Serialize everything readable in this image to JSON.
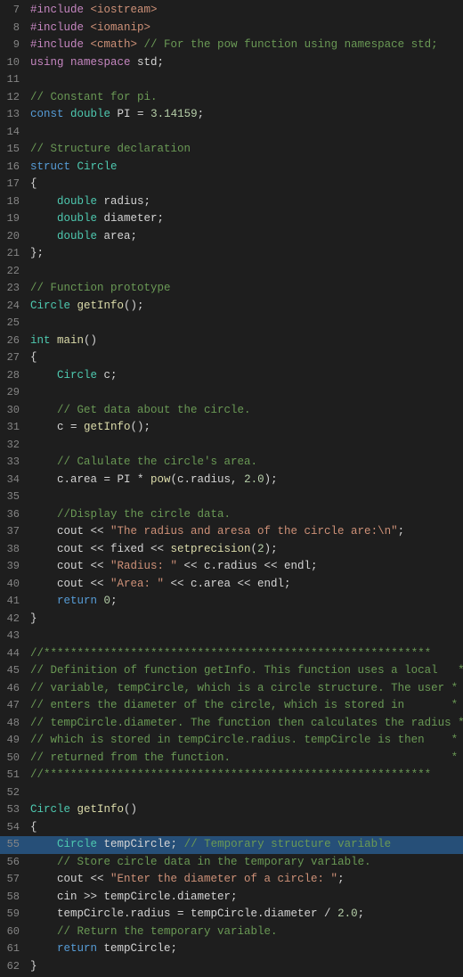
{
  "lines": [
    {
      "num": 7,
      "tokens": [
        {
          "t": "pp",
          "v": "#include"
        },
        {
          "t": "plain",
          "v": " "
        },
        {
          "t": "inc",
          "v": "<iostream>"
        }
      ]
    },
    {
      "num": 8,
      "tokens": [
        {
          "t": "pp",
          "v": "#include"
        },
        {
          "t": "plain",
          "v": " "
        },
        {
          "t": "inc",
          "v": "<iomanip>"
        }
      ]
    },
    {
      "num": 9,
      "tokens": [
        {
          "t": "pp",
          "v": "#include"
        },
        {
          "t": "plain",
          "v": " "
        },
        {
          "t": "inc",
          "v": "<cmath>"
        },
        {
          "t": "cmt",
          "v": " // For the pow function using namespace std;"
        }
      ]
    },
    {
      "num": 10,
      "tokens": [
        {
          "t": "kw2",
          "v": "using"
        },
        {
          "t": "plain",
          "v": " "
        },
        {
          "t": "kw2",
          "v": "namespace"
        },
        {
          "t": "plain",
          "v": " std;"
        }
      ]
    },
    {
      "num": 11,
      "tokens": []
    },
    {
      "num": 12,
      "tokens": [
        {
          "t": "cmt",
          "v": "// Constant for pi."
        }
      ]
    },
    {
      "num": 13,
      "tokens": [
        {
          "t": "kw",
          "v": "const"
        },
        {
          "t": "plain",
          "v": " "
        },
        {
          "t": "type",
          "v": "double"
        },
        {
          "t": "plain",
          "v": " PI = "
        },
        {
          "t": "num",
          "v": "3.14159"
        },
        {
          "t": "plain",
          "v": ";"
        }
      ]
    },
    {
      "num": 14,
      "tokens": []
    },
    {
      "num": 15,
      "tokens": [
        {
          "t": "cmt",
          "v": "// Structure declaration"
        }
      ]
    },
    {
      "num": 16,
      "tokens": [
        {
          "t": "kw",
          "v": "struct"
        },
        {
          "t": "plain",
          "v": " "
        },
        {
          "t": "type",
          "v": "Circle"
        }
      ]
    },
    {
      "num": 17,
      "tokens": [
        {
          "t": "plain",
          "v": "{"
        }
      ]
    },
    {
      "num": 18,
      "tokens": [
        {
          "t": "plain",
          "v": "    "
        },
        {
          "t": "type",
          "v": "double"
        },
        {
          "t": "plain",
          "v": " radius;"
        }
      ]
    },
    {
      "num": 19,
      "tokens": [
        {
          "t": "plain",
          "v": "    "
        },
        {
          "t": "type",
          "v": "double"
        },
        {
          "t": "plain",
          "v": " diameter;"
        }
      ]
    },
    {
      "num": 20,
      "tokens": [
        {
          "t": "plain",
          "v": "    "
        },
        {
          "t": "type",
          "v": "double"
        },
        {
          "t": "plain",
          "v": " area;"
        }
      ]
    },
    {
      "num": 21,
      "tokens": [
        {
          "t": "plain",
          "v": "};"
        }
      ]
    },
    {
      "num": 22,
      "tokens": []
    },
    {
      "num": 23,
      "tokens": [
        {
          "t": "cmt",
          "v": "// Function prototype"
        }
      ]
    },
    {
      "num": 24,
      "tokens": [
        {
          "t": "type",
          "v": "Circle"
        },
        {
          "t": "plain",
          "v": " "
        },
        {
          "t": "fn",
          "v": "getInfo"
        },
        {
          "t": "plain",
          "v": "();"
        }
      ]
    },
    {
      "num": 25,
      "tokens": []
    },
    {
      "num": 26,
      "tokens": [
        {
          "t": "type",
          "v": "int"
        },
        {
          "t": "plain",
          "v": " "
        },
        {
          "t": "fn",
          "v": "main"
        },
        {
          "t": "plain",
          "v": "()"
        }
      ]
    },
    {
      "num": 27,
      "tokens": [
        {
          "t": "plain",
          "v": "{"
        }
      ]
    },
    {
      "num": 28,
      "tokens": [
        {
          "t": "plain",
          "v": "    "
        },
        {
          "t": "type",
          "v": "Circle"
        },
        {
          "t": "plain",
          "v": " c;"
        }
      ]
    },
    {
      "num": 29,
      "tokens": []
    },
    {
      "num": 30,
      "tokens": [
        {
          "t": "plain",
          "v": "    "
        },
        {
          "t": "cmt",
          "v": "// Get data about the circle."
        }
      ]
    },
    {
      "num": 31,
      "tokens": [
        {
          "t": "plain",
          "v": "    c = "
        },
        {
          "t": "fn",
          "v": "getInfo"
        },
        {
          "t": "plain",
          "v": "();"
        }
      ]
    },
    {
      "num": 32,
      "tokens": []
    },
    {
      "num": 33,
      "tokens": [
        {
          "t": "plain",
          "v": "    "
        },
        {
          "t": "cmt",
          "v": "// Calulate the circle's area."
        }
      ]
    },
    {
      "num": 34,
      "tokens": [
        {
          "t": "plain",
          "v": "    c.area = PI * "
        },
        {
          "t": "fn",
          "v": "pow"
        },
        {
          "t": "plain",
          "v": "(c.radius, "
        },
        {
          "t": "num",
          "v": "2.0"
        },
        {
          "t": "plain",
          "v": ");"
        }
      ]
    },
    {
      "num": 35,
      "tokens": []
    },
    {
      "num": 36,
      "tokens": [
        {
          "t": "plain",
          "v": "    "
        },
        {
          "t": "cmt",
          "v": "//Display the circle data."
        }
      ]
    },
    {
      "num": 37,
      "tokens": [
        {
          "t": "plain",
          "v": "    cout << "
        },
        {
          "t": "str",
          "v": "\"The radius and aresa of the circle are:\\n\""
        },
        {
          "t": "plain",
          "v": ";"
        }
      ]
    },
    {
      "num": 38,
      "tokens": [
        {
          "t": "plain",
          "v": "    cout << fixed << "
        },
        {
          "t": "fn",
          "v": "setprecision"
        },
        {
          "t": "plain",
          "v": "("
        },
        {
          "t": "num",
          "v": "2"
        },
        {
          "t": "plain",
          "v": ");"
        }
      ]
    },
    {
      "num": 39,
      "tokens": [
        {
          "t": "plain",
          "v": "    cout << "
        },
        {
          "t": "str",
          "v": "\"Radius: \""
        },
        {
          "t": "plain",
          "v": " << c.radius << endl;"
        }
      ]
    },
    {
      "num": 40,
      "tokens": [
        {
          "t": "plain",
          "v": "    cout << "
        },
        {
          "t": "str",
          "v": "\"Area: \""
        },
        {
          "t": "plain",
          "v": " << c.area << endl;"
        }
      ]
    },
    {
      "num": 41,
      "tokens": [
        {
          "t": "plain",
          "v": "    "
        },
        {
          "t": "kw",
          "v": "return"
        },
        {
          "t": "plain",
          "v": " "
        },
        {
          "t": "num",
          "v": "0"
        },
        {
          "t": "plain",
          "v": ";"
        }
      ]
    },
    {
      "num": 42,
      "tokens": [
        {
          "t": "plain",
          "v": "}"
        }
      ]
    },
    {
      "num": 43,
      "tokens": []
    },
    {
      "num": 44,
      "tokens": [
        {
          "t": "cmt",
          "v": "//**********************************************************"
        }
      ]
    },
    {
      "num": 45,
      "tokens": [
        {
          "t": "cmt",
          "v": "// Definition of function getInfo. This function uses a local   *"
        }
      ]
    },
    {
      "num": 46,
      "tokens": [
        {
          "t": "cmt",
          "v": "// variable, tempCircle, which is a circle structure. The user *"
        }
      ]
    },
    {
      "num": 47,
      "tokens": [
        {
          "t": "cmt",
          "v": "// enters the diameter of the circle, which is stored in       *"
        }
      ]
    },
    {
      "num": 48,
      "tokens": [
        {
          "t": "cmt",
          "v": "// tempCircle.diameter. The function then calculates the radius *"
        }
      ]
    },
    {
      "num": 49,
      "tokens": [
        {
          "t": "cmt",
          "v": "// which is stored in tempCircle.radius. tempCircle is then    *"
        }
      ]
    },
    {
      "num": 50,
      "tokens": [
        {
          "t": "cmt",
          "v": "// returned from the function.                                 *"
        }
      ]
    },
    {
      "num": 51,
      "tokens": [
        {
          "t": "cmt",
          "v": "//**********************************************************"
        }
      ]
    },
    {
      "num": 52,
      "tokens": []
    },
    {
      "num": 53,
      "tokens": [
        {
          "t": "type",
          "v": "Circle"
        },
        {
          "t": "plain",
          "v": " "
        },
        {
          "t": "fn",
          "v": "getInfo"
        },
        {
          "t": "plain",
          "v": "()"
        }
      ]
    },
    {
      "num": 54,
      "tokens": [
        {
          "t": "plain",
          "v": "{"
        }
      ]
    },
    {
      "num": 55,
      "tokens": [
        {
          "t": "plain",
          "v": "    "
        },
        {
          "t": "type",
          "v": "Circle"
        },
        {
          "t": "plain",
          "v": " tempCircle; "
        },
        {
          "t": "cmt",
          "v": "// Temporary structure variable"
        }
      ],
      "highlight": true
    },
    {
      "num": 56,
      "tokens": [
        {
          "t": "plain",
          "v": "    "
        },
        {
          "t": "cmt",
          "v": "// Store circle data in the temporary variable."
        }
      ]
    },
    {
      "num": 57,
      "tokens": [
        {
          "t": "plain",
          "v": "    cout << "
        },
        {
          "t": "str",
          "v": "\"Enter the diameter of a circle: \""
        },
        {
          "t": "plain",
          "v": ";"
        }
      ]
    },
    {
      "num": 58,
      "tokens": [
        {
          "t": "plain",
          "v": "    cin >> tempCircle.diameter;"
        }
      ]
    },
    {
      "num": 59,
      "tokens": [
        {
          "t": "plain",
          "v": "    tempCircle.radius = tempCircle.diameter / "
        },
        {
          "t": "num",
          "v": "2.0"
        },
        {
          "t": "plain",
          "v": ";"
        }
      ]
    },
    {
      "num": 60,
      "tokens": [
        {
          "t": "plain",
          "v": "    "
        },
        {
          "t": "cmt",
          "v": "// Return the temporary variable."
        }
      ]
    },
    {
      "num": 61,
      "tokens": [
        {
          "t": "plain",
          "v": "    "
        },
        {
          "t": "kw",
          "v": "return"
        },
        {
          "t": "plain",
          "v": " tempCircle;"
        }
      ]
    },
    {
      "num": 62,
      "tokens": [
        {
          "t": "plain",
          "v": "}"
        }
      ]
    }
  ]
}
